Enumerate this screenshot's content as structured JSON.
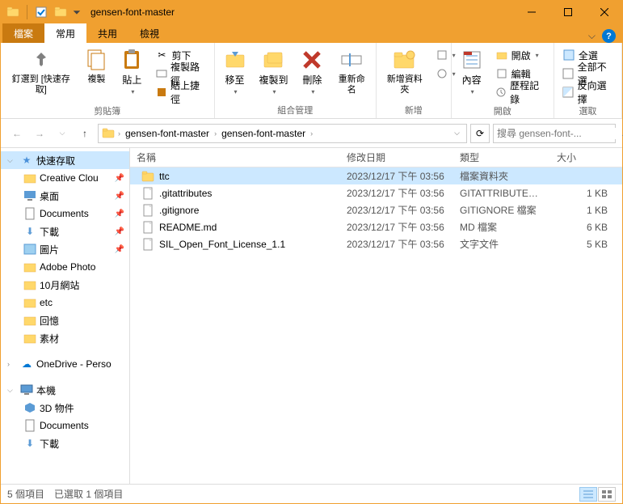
{
  "title": "gensen-font-master",
  "ribbon": {
    "tabs": {
      "file": "檔案",
      "home": "常用",
      "share": "共用",
      "view": "檢視"
    },
    "groups": {
      "clipboard": {
        "label": "剪貼簿",
        "pin": "釘選到 [快速存取]",
        "copy": "複製",
        "paste": "貼上",
        "cut": "剪下",
        "copypath": "複製路徑",
        "pasteshortcut": "貼上捷徑"
      },
      "organize": {
        "label": "組合管理",
        "moveto": "移至",
        "copyto": "複製到",
        "delete": "刪除",
        "rename": "重新命名"
      },
      "new": {
        "label": "新增",
        "newfolder": "新增資料夾"
      },
      "open": {
        "label": "開啟",
        "properties": "內容",
        "open": "開啟",
        "edit": "編輯",
        "history": "歷程記錄"
      },
      "select": {
        "label": "選取",
        "selectall": "全選",
        "selectnone": "全部不選",
        "invert": "反向選擇"
      }
    }
  },
  "breadcrumb": [
    "gensen-font-master",
    "gensen-font-master"
  ],
  "search_placeholder": "搜尋 gensen-font-...",
  "columns": {
    "name": "名稱",
    "date": "修改日期",
    "type": "類型",
    "size": "大小"
  },
  "sidebar": {
    "quick": "快速存取",
    "items": [
      "Creative Clou",
      "桌面",
      "Documents",
      "下載",
      "圖片",
      "Adobe Photo",
      "10月網站",
      "etc",
      "回憶",
      "素材"
    ],
    "onedrive": "OneDrive - Perso",
    "thispc": "本機",
    "pcitems": [
      "3D 物件",
      "Documents",
      "下載"
    ]
  },
  "files": [
    {
      "name": "ttc",
      "date": "2023/12/17 下午 03:56",
      "type": "檔案資料夾",
      "size": "",
      "folder": true,
      "selected": true
    },
    {
      "name": ".gitattributes",
      "date": "2023/12/17 下午 03:56",
      "type": "GITATTRIBUTES ...",
      "size": "1 KB",
      "folder": false
    },
    {
      "name": ".gitignore",
      "date": "2023/12/17 下午 03:56",
      "type": "GITIGNORE 檔案",
      "size": "1 KB",
      "folder": false
    },
    {
      "name": "README.md",
      "date": "2023/12/17 下午 03:56",
      "type": "MD 檔案",
      "size": "6 KB",
      "folder": false
    },
    {
      "name": "SIL_Open_Font_License_1.1",
      "date": "2023/12/17 下午 03:56",
      "type": "文字文件",
      "size": "5 KB",
      "folder": false
    }
  ],
  "status": {
    "count": "5 個項目",
    "selected": "已選取 1 個項目"
  }
}
